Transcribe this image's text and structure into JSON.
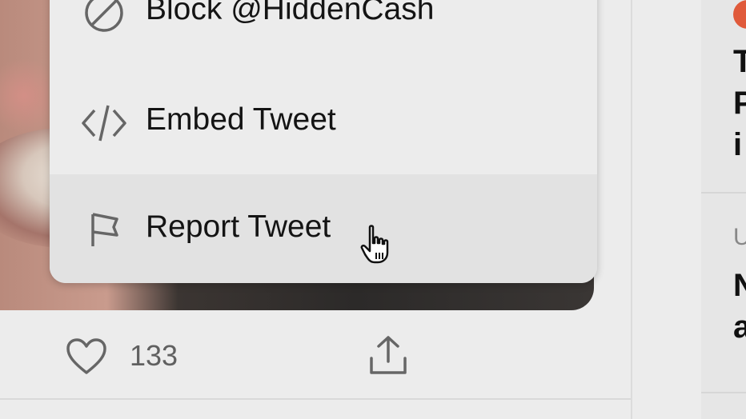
{
  "menu": {
    "items": [
      {
        "label": "Block @HiddenCash",
        "icon": "block-icon"
      },
      {
        "label": "Embed Tweet",
        "icon": "code-icon"
      },
      {
        "label": "Report Tweet",
        "icon": "flag-icon"
      }
    ]
  },
  "tweet": {
    "like_count": "133",
    "like_icon": "heart-icon",
    "share_icon": "share-icon"
  },
  "sidebar": {
    "trend1_lines": [
      "T",
      "P",
      "i"
    ],
    "trend2_meta": "U",
    "trend2_lines": [
      "N",
      "a"
    ]
  },
  "colors": {
    "menu_bg": "#ececec",
    "menu_hover": "#e2e2e2",
    "text": "#141414",
    "muted": "#606060",
    "avatar": "#e05a3b"
  }
}
